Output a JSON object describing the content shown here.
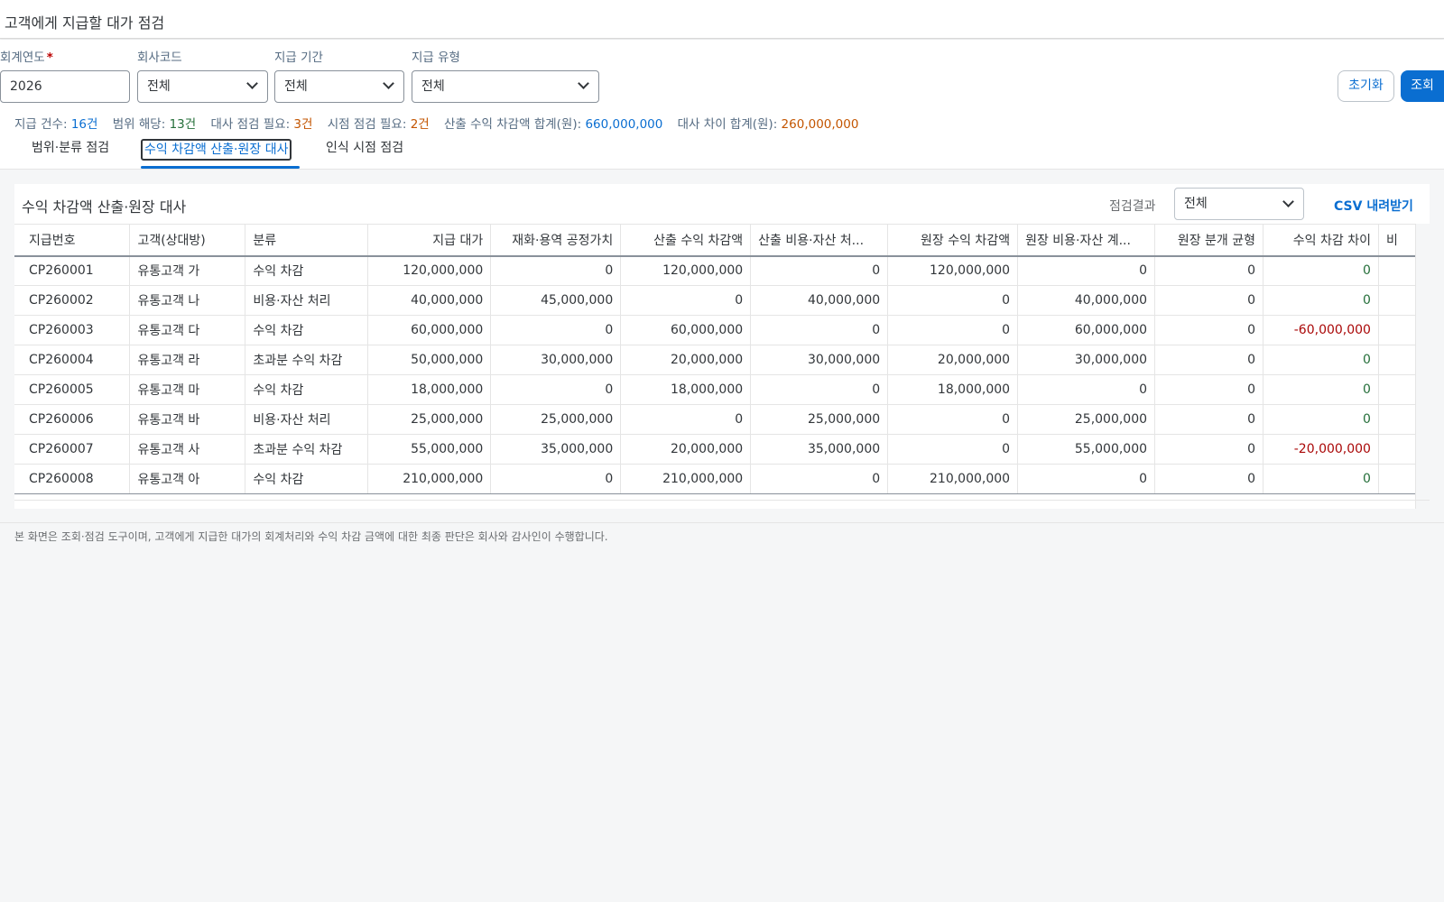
{
  "header": {
    "title": "고객에게 지급할 대가 점검"
  },
  "filters": {
    "fiscal_year": {
      "label": "회계연도",
      "required_mark": "*",
      "value": "2026"
    },
    "company_code": {
      "label": "회사코드",
      "value": "전체"
    },
    "payment_period": {
      "label": "지급 기간",
      "value": "전체"
    },
    "payment_type": {
      "label": "지급 유형",
      "value": "전체"
    }
  },
  "buttons": {
    "reset": "초기화",
    "search": "조회"
  },
  "summary": {
    "count_label": "지급 건수:",
    "count_value": "16건",
    "scope_label": "범위 해당:",
    "scope_value": "13건",
    "recon_label": "대사 점검 필요:",
    "recon_value": "3건",
    "timing_label": "시점 점검 필요:",
    "timing_value": "2건",
    "calc_total_label": "산출 수익 차감액 합계(원):",
    "calc_total_value": "660,000,000",
    "diff_total_label": "대사 차이 합계(원):",
    "diff_total_value": "260,000,000"
  },
  "tabs": [
    {
      "label": "범위·분류 점검"
    },
    {
      "label": "수익 차감액 산출·원장 대사"
    },
    {
      "label": "인식 시점 점검"
    }
  ],
  "panel": {
    "title": "수익 차감액 산출·원장 대사",
    "filter_label": "점검결과",
    "filter_value": "전체",
    "csv_label": "CSV 내려받기"
  },
  "table": {
    "columns": [
      "지급번호",
      "고객(상대방)",
      "분류",
      "지급 대가",
      "재화·용역 공정가치",
      "산출 수익 차감액",
      "산출 비용·자산 처...",
      "원장 수익 차감액",
      "원장 비용·자산 계...",
      "원장 분개 균형",
      "수익 차감 차이",
      "비"
    ],
    "rows": [
      [
        "CP260001",
        "유통고객 가",
        "수익 차감",
        "120,000,000",
        "0",
        "120,000,000",
        "0",
        "120,000,000",
        "0",
        "0",
        "0"
      ],
      [
        "CP260002",
        "유통고객 나",
        "비용·자산 처리",
        "40,000,000",
        "45,000,000",
        "0",
        "40,000,000",
        "0",
        "40,000,000",
        "0",
        "0"
      ],
      [
        "CP260003",
        "유통고객 다",
        "수익 차감",
        "60,000,000",
        "0",
        "60,000,000",
        "0",
        "0",
        "60,000,000",
        "0",
        "-60,000,000"
      ],
      [
        "CP260004",
        "유통고객 라",
        "초과분 수익 차감",
        "50,000,000",
        "30,000,000",
        "20,000,000",
        "30,000,000",
        "20,000,000",
        "30,000,000",
        "0",
        "0"
      ],
      [
        "CP260005",
        "유통고객 마",
        "수익 차감",
        "18,000,000",
        "0",
        "18,000,000",
        "0",
        "18,000,000",
        "0",
        "0",
        "0"
      ],
      [
        "CP260006",
        "유통고객 바",
        "비용·자산 처리",
        "25,000,000",
        "25,000,000",
        "0",
        "25,000,000",
        "0",
        "25,000,000",
        "0",
        "0"
      ],
      [
        "CP260007",
        "유통고객 사",
        "초과분 수익 차감",
        "55,000,000",
        "35,000,000",
        "20,000,000",
        "35,000,000",
        "0",
        "55,000,000",
        "0",
        "-20,000,000"
      ],
      [
        "CP260008",
        "유통고객 아",
        "수익 차감",
        "210,000,000",
        "0",
        "210,000,000",
        "0",
        "210,000,000",
        "0",
        "0",
        "0"
      ]
    ]
  },
  "footer": {
    "note": "본 화면은 조회·점검 도구이며, 고객에게 지급한 대가의 회계처리와 수익 차감 금액에 대한 최종 판단은 회사와 감사인이 수행합니다."
  }
}
